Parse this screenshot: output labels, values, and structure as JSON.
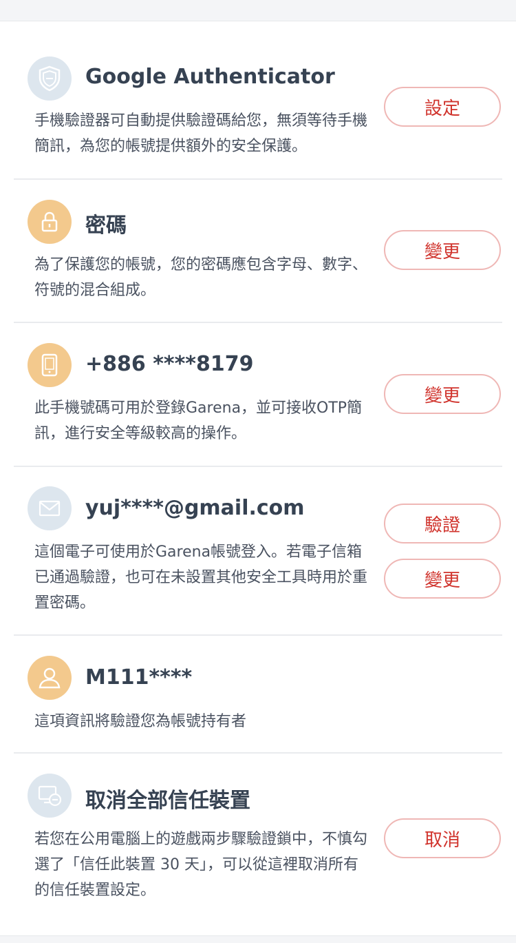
{
  "colors": {
    "accent": "#d0332c",
    "button_border": "#efb7b5",
    "icon_blue": "#dde6ee",
    "icon_orange": "#f3c98d",
    "divider": "#e9ebee"
  },
  "items": [
    {
      "icon": "shield-icon",
      "title": "Google Authenticator",
      "description": "手機驗證器可自動提供驗證碼給您，無須等待手機簡訊，為您的帳號提供額外的安全保護。",
      "buttons": [
        "設定"
      ]
    },
    {
      "icon": "lock-icon",
      "title": "密碼",
      "description": "為了保護您的帳號，您的密碼應包含字母、數字、符號的混合組成。",
      "buttons": [
        "變更"
      ]
    },
    {
      "icon": "phone-icon",
      "title": "+886 ****8179",
      "description": "此手機號碼可用於登錄Garena，並可接收OTP簡訊，進行安全等級較高的操作。",
      "buttons": [
        "變更"
      ]
    },
    {
      "icon": "envelope-icon",
      "title": "yuj****@gmail.com",
      "description": "這個電子可使用於Garena帳號登入。若電子信箱已通過驗證，也可在未設置其他安全工具時用於重置密碼。",
      "buttons": [
        "驗證",
        "變更"
      ]
    },
    {
      "icon": "user-id-icon",
      "title": "M111****",
      "description": "這項資訊將驗證您為帳號持有者",
      "buttons": []
    },
    {
      "icon": "device-remove-icon",
      "title": "取消全部信任裝置",
      "description": "若您在公用電腦上的遊戲兩步驟驗證鎖中，不慎勾選了「信任此裝置 30 天」，可以從這裡取消所有的信任裝置設定。",
      "buttons": [
        "取消"
      ]
    }
  ]
}
